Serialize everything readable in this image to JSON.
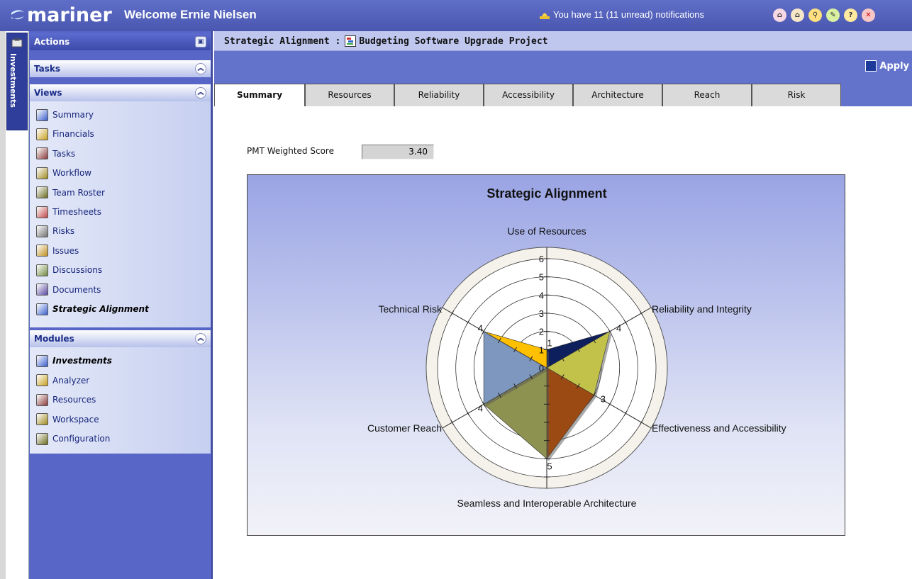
{
  "header": {
    "logo_text": "mariner",
    "welcome": "Welcome Ernie Nielsen",
    "notifications": "You have 11 (11 unread) notifications"
  },
  "side_tab": {
    "label": "Investments"
  },
  "sidebar": {
    "actions_title": "Actions",
    "tasks_title": "Tasks",
    "views_title": "Views",
    "views": [
      {
        "label": "Summary",
        "icon": "summary-icon"
      },
      {
        "label": "Financials",
        "icon": "financials-icon"
      },
      {
        "label": "Tasks",
        "icon": "tasks-icon"
      },
      {
        "label": "Workflow",
        "icon": "workflow-icon"
      },
      {
        "label": "Team Roster",
        "icon": "team-roster-icon"
      },
      {
        "label": "Timesheets",
        "icon": "timesheets-icon"
      },
      {
        "label": "Risks",
        "icon": "risks-icon"
      },
      {
        "label": "Issues",
        "icon": "issues-icon"
      },
      {
        "label": "Discussions",
        "icon": "discussions-icon"
      },
      {
        "label": "Documents",
        "icon": "documents-icon"
      },
      {
        "label": "Strategic Alignment",
        "icon": "strategic-alignment-icon",
        "active": true
      }
    ],
    "modules_title": "Modules",
    "modules": [
      {
        "label": "Investments",
        "icon": "investments-icon",
        "active": true
      },
      {
        "label": "Analyzer",
        "icon": "analyzer-icon"
      },
      {
        "label": "Resources",
        "icon": "resources-icon"
      },
      {
        "label": "Workspace",
        "icon": "workspace-icon"
      },
      {
        "label": "Configuration",
        "icon": "configuration-icon"
      }
    ]
  },
  "main": {
    "title_prefix": "Strategic Alignment :",
    "project_name": "Budgeting Software Upgrade Project",
    "apply_label": "Apply",
    "tabs": [
      "Summary",
      "Resources",
      "Reliability",
      "Accessibility",
      "Architecture",
      "Reach",
      "Risk"
    ],
    "active_tab": "Summary",
    "score_label": "PMT Weighted Score",
    "score_value": "3.40"
  },
  "chart_data": {
    "type": "radar",
    "title": "Strategic Alignment",
    "categories": [
      "Use of Resources",
      "Reliability and Integrity",
      "Effectiveness and Accessibility",
      "Seamless and Interoperable Architecture",
      "Customer Reach",
      "Technical Risk"
    ],
    "values": [
      1,
      4,
      3,
      5,
      4,
      4
    ],
    "rlim": [
      0,
      6
    ],
    "ticks": [
      0,
      1,
      2,
      3,
      4,
      5,
      6
    ],
    "colors": [
      "#0e1f5e",
      "#c2c24a",
      "#9a4a12",
      "#8e9250",
      "#7d97bf",
      "#ffc000"
    ]
  }
}
